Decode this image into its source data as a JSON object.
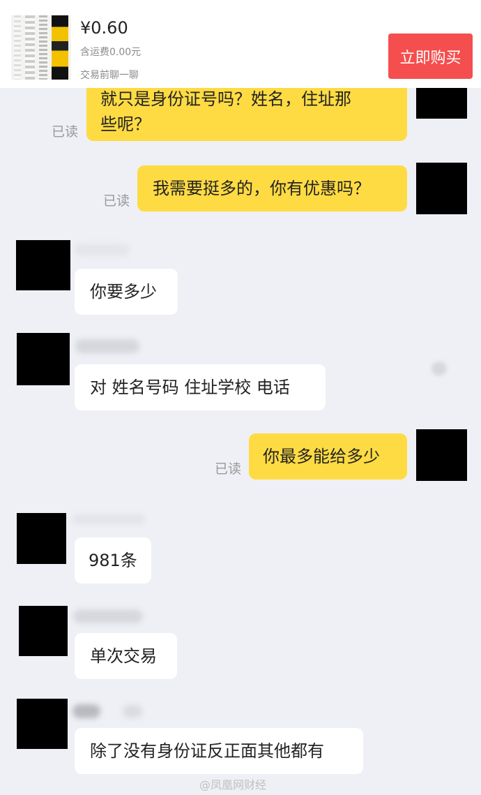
{
  "product": {
    "price": "¥0.60",
    "shipping": "含运费0.00元",
    "chat_note": "交易前聊一聊",
    "buy_label": "立即购买"
  },
  "messages": [
    {
      "direction": "out",
      "lines": [
        "就只是身份证号吗？姓名，住址那",
        "些呢？"
      ],
      "read": "已读"
    },
    {
      "direction": "out",
      "lines": [
        "我需要挺多的，你有优惠吗？"
      ],
      "read": "已读"
    },
    {
      "direction": "in",
      "lines": [
        "你要多少"
      ]
    },
    {
      "direction": "in",
      "lines": [
        "对 姓名号码 住址学校 电话"
      ]
    },
    {
      "direction": "out",
      "lines": [
        "你最多能给多少"
      ],
      "read": "已读"
    },
    {
      "direction": "in",
      "lines": [
        "981条"
      ]
    },
    {
      "direction": "in",
      "lines": [
        "单次交易"
      ]
    },
    {
      "direction": "in",
      "lines": [
        "除了没有身份证反正面其他都有"
      ]
    }
  ],
  "watermark": "@凤凰网财经",
  "colors": {
    "background": "#eef0f5",
    "outgoing_bubble": "#fedb43",
    "incoming_bubble": "#ffffff",
    "buy_button": "#f54e4e",
    "read_text": "#999999"
  }
}
